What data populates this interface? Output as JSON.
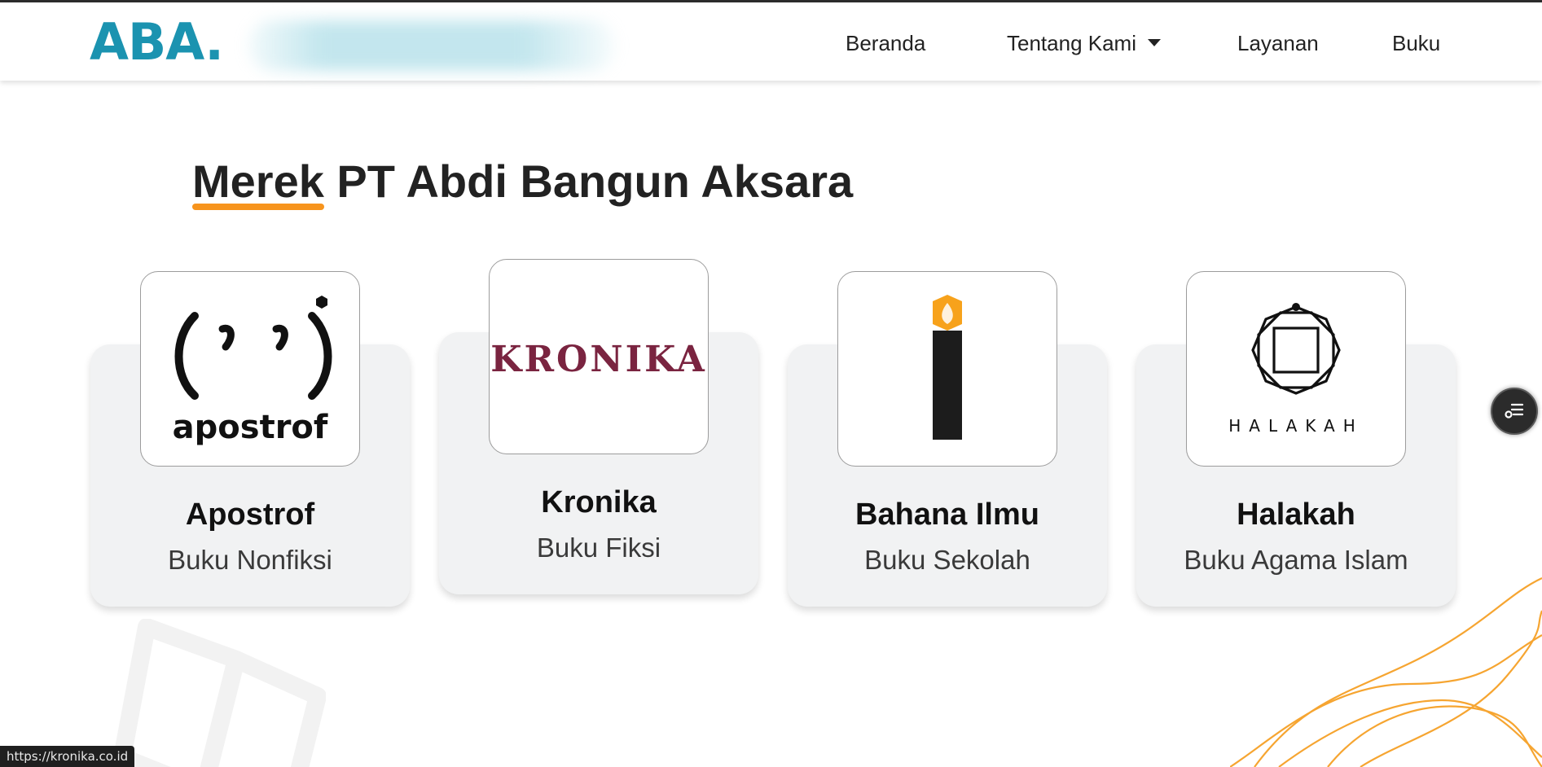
{
  "header": {
    "brand": "ABA.",
    "nav": [
      {
        "label": "Beranda"
      },
      {
        "label": "Tentang Kami",
        "has_dropdown": true
      },
      {
        "label": "Layanan"
      },
      {
        "label": "Buku"
      }
    ]
  },
  "main": {
    "heading_highlight": "Merek",
    "heading_rest": " PT Abdi Bangun Aksara",
    "brands": [
      {
        "name": "Apostrof",
        "category": "Buku Nonfiksi",
        "logo_text": "apostrof",
        "logo_icon": "apostrof-face-logo"
      },
      {
        "name": "Kronika",
        "category": "Buku Fiksi",
        "logo_text": "KRONIKA",
        "logo_icon": "kronika-wordmark-logo"
      },
      {
        "name": "Bahana Ilmu",
        "category": "Buku Sekolah",
        "logo_text": "",
        "logo_icon": "candle-flame-logo"
      },
      {
        "name": "Halakah",
        "category": "Buku Agama Islam",
        "logo_text": "HALAKAH",
        "logo_icon": "octagram-star-logo"
      }
    ]
  },
  "status_bar": {
    "url": "https://kronika.co.id"
  },
  "floating_button": {
    "icon": "menu-list-icon"
  },
  "colors": {
    "brand": "#1b93b0",
    "accent_underline": "#f7941d",
    "kronika": "#7a2440",
    "card_bg": "#f1f2f3",
    "wave_lines": "#f6a531"
  }
}
